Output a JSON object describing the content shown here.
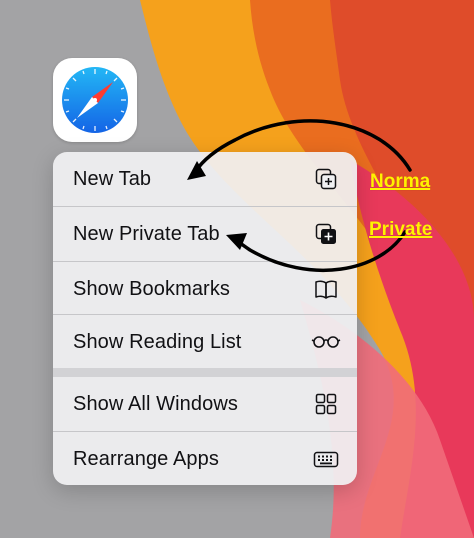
{
  "colors": {
    "accent": "#1a7cf3",
    "annotation_text": "#fff200",
    "arrow": "#000000",
    "menu_text": "#111114"
  },
  "menu": {
    "items": [
      {
        "label": "New Tab",
        "icon": "new-tab-icon"
      },
      {
        "label": "New Private Tab",
        "icon": "new-private-tab-icon"
      },
      {
        "label": "Show Bookmarks",
        "icon": "book-icon"
      },
      {
        "label": "Show Reading List",
        "icon": "glasses-icon"
      },
      {
        "label": "Show All Windows",
        "icon": "grid-icon"
      },
      {
        "label": "Rearrange Apps",
        "icon": "keyboard-icon"
      }
    ]
  },
  "annotations": {
    "normal": "Norma",
    "private": "Private"
  }
}
